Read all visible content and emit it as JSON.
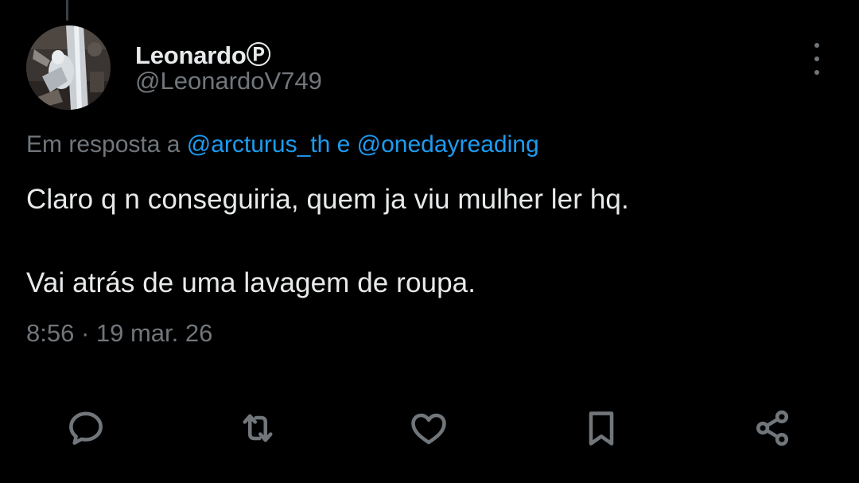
{
  "author": {
    "display_name": "Leonardo",
    "badge_glyph": "Ⓟ",
    "handle": "@LeonardoV749"
  },
  "reply_context": {
    "prefix": "Em resposta a",
    "mention_1": "@arcturus_th",
    "conjunction": "e",
    "mention_2": "@onedayreading"
  },
  "tweet": {
    "line_1": "Claro q n conseguiria, quem ja viu mulher ler hq.",
    "line_2": "Vai atrás de uma lavagem de roupa.",
    "timestamp": "8:56 · 19 mar. 26"
  },
  "icons": {
    "more": "more-vertical-icon",
    "reply": "reply-icon",
    "repost": "repost-icon",
    "like": "heart-icon",
    "bookmark": "bookmark-icon",
    "share": "share-icon"
  },
  "colors": {
    "background": "#000000",
    "text_primary": "#e7e9ea",
    "text_secondary": "#71767b",
    "mention_link": "#1d9bf0"
  }
}
